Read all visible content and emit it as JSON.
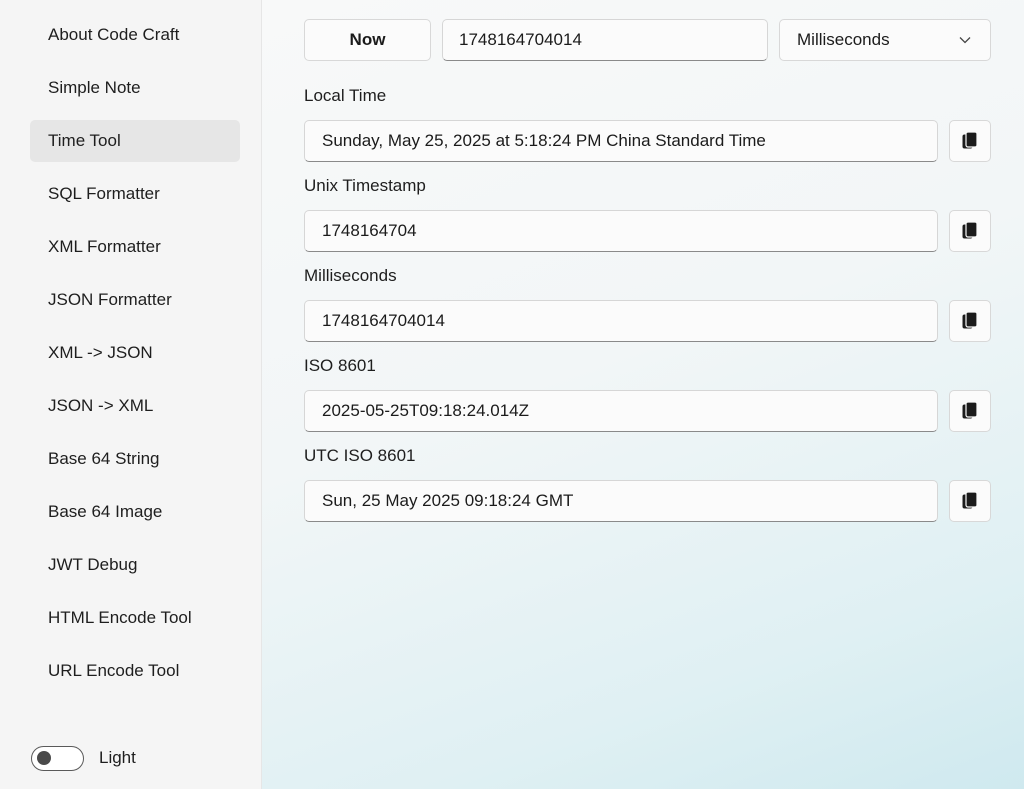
{
  "sidebar": {
    "items": [
      {
        "label": "About Code Craft"
      },
      {
        "label": "Simple Note"
      },
      {
        "label": "Time Tool"
      },
      {
        "label": "SQL Formatter"
      },
      {
        "label": "XML Formatter"
      },
      {
        "label": "JSON Formatter"
      },
      {
        "label": "XML -> JSON"
      },
      {
        "label": "JSON -> XML"
      },
      {
        "label": "Base 64 String"
      },
      {
        "label": "Base 64 Image"
      },
      {
        "label": "JWT Debug"
      },
      {
        "label": "HTML Encode Tool"
      },
      {
        "label": "URL Encode Tool"
      }
    ],
    "active_index": 2,
    "theme_toggle": {
      "label": "Light",
      "on": false
    }
  },
  "toolbar": {
    "now_label": "Now",
    "timestamp_value": "1748164704014",
    "unit_selected": "Milliseconds"
  },
  "fields": {
    "local_time": {
      "label": "Local Time",
      "value": "Sunday, May 25, 2025 at 5:18:24 PM China Standard Time"
    },
    "unix_timestamp": {
      "label": "Unix Timestamp",
      "value": "1748164704"
    },
    "milliseconds": {
      "label": "Milliseconds",
      "value": "1748164704014"
    },
    "iso_8601": {
      "label": "ISO 8601",
      "value": "2025-05-25T09:18:24.014Z"
    },
    "utc_iso_8601": {
      "label": "UTC ISO 8601",
      "value": "Sun, 25 May 2025 09:18:24 GMT"
    }
  },
  "colors": {
    "sidebar_bg": "#f5f5f5",
    "active_item_bg": "#e6e6e6",
    "accent_gradient_end": "#cfe9ef"
  },
  "icons": {
    "copy": "copy-icon",
    "dropdown": "chevron-down-icon"
  }
}
